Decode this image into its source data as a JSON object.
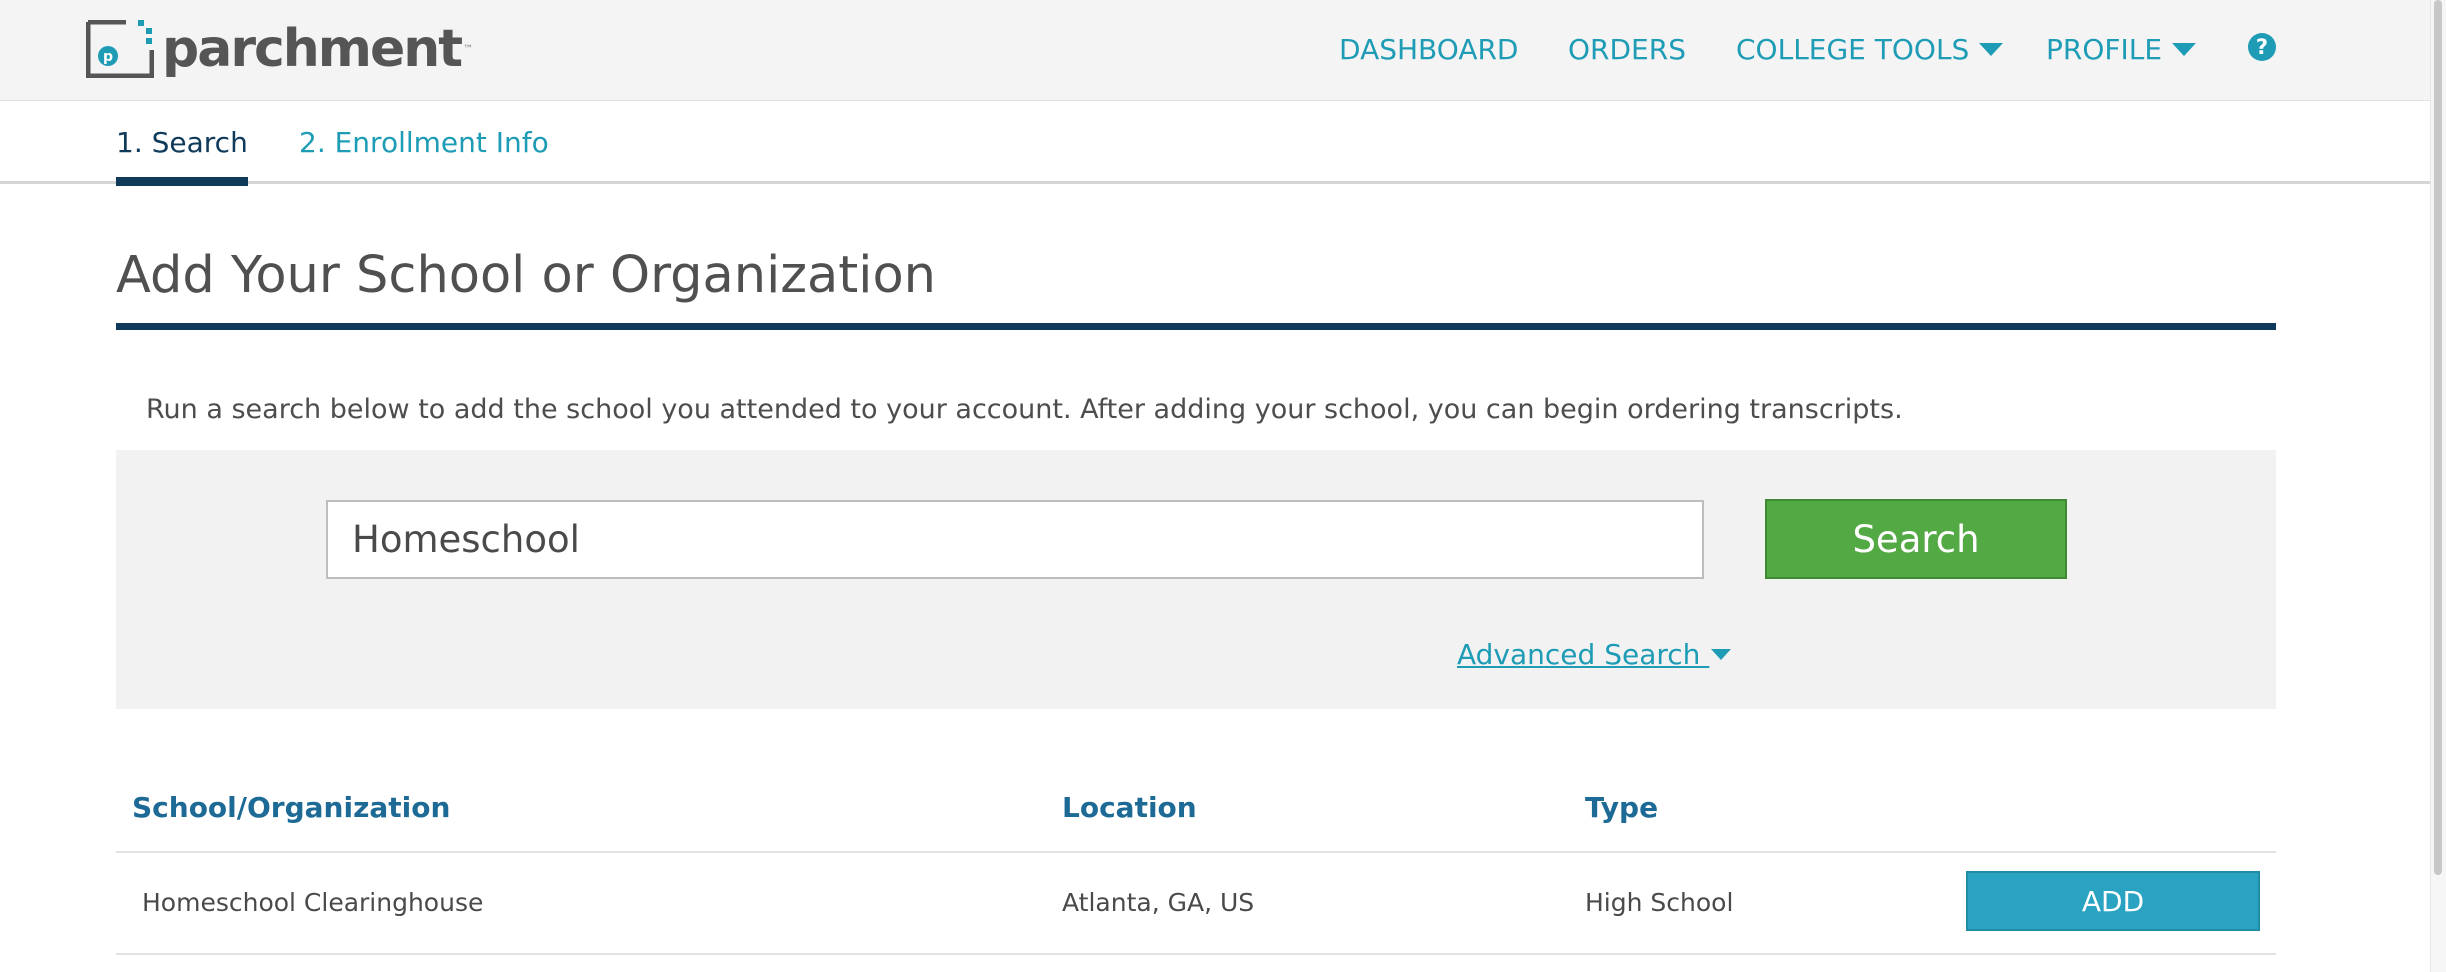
{
  "header": {
    "logo_text": "parchment",
    "nav": [
      {
        "label": "DASHBOARD"
      },
      {
        "label": "ORDERS"
      },
      {
        "label": "COLLEGE TOOLS",
        "has_dropdown": true
      },
      {
        "label": "PROFILE",
        "has_dropdown": true
      }
    ],
    "help_glyph": "?"
  },
  "steps": {
    "items": [
      {
        "label": "1. Search",
        "active": true
      },
      {
        "label": "2. Enrollment Info",
        "active": false
      }
    ]
  },
  "main": {
    "title": "Add Your School or Organization",
    "intro": "Run a search below to add the school you attended to your account. After adding your school, you can begin ordering transcripts.",
    "search": {
      "value": "Homeschool",
      "button_label": "Search",
      "advanced_label": "Advanced Search"
    },
    "results": {
      "columns": [
        "School/Organization",
        "Location",
        "Type"
      ],
      "rows": [
        {
          "name": "Homeschool Clearinghouse",
          "location": "Atlanta, GA, US",
          "type": "High School",
          "action": "ADD"
        }
      ]
    }
  },
  "colors": {
    "accent": "#1e9cb6",
    "navy": "#0f3a5a",
    "search_button": "#53a944",
    "add_button": "#2aa3c2",
    "header_bg": "#f4f4f4"
  },
  "icons": {
    "logo": "parchment-logo-icon",
    "dropdown": "caret-down-icon",
    "help": "question-circle-icon"
  }
}
